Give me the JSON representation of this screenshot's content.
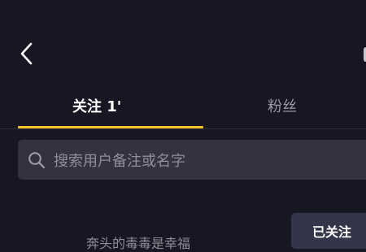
{
  "header": {
    "back_icon": "chevron-left-icon"
  },
  "tabs": {
    "following_label": "关注 1'",
    "fans_label": "粉丝",
    "active_color": "#f5c42c"
  },
  "search": {
    "placeholder": "搜索用户备注或名字",
    "icon": "search-icon"
  },
  "list": {
    "items": [
      {
        "name": "奔头的毒毒是幸福",
        "button_label": "已关注"
      }
    ]
  }
}
